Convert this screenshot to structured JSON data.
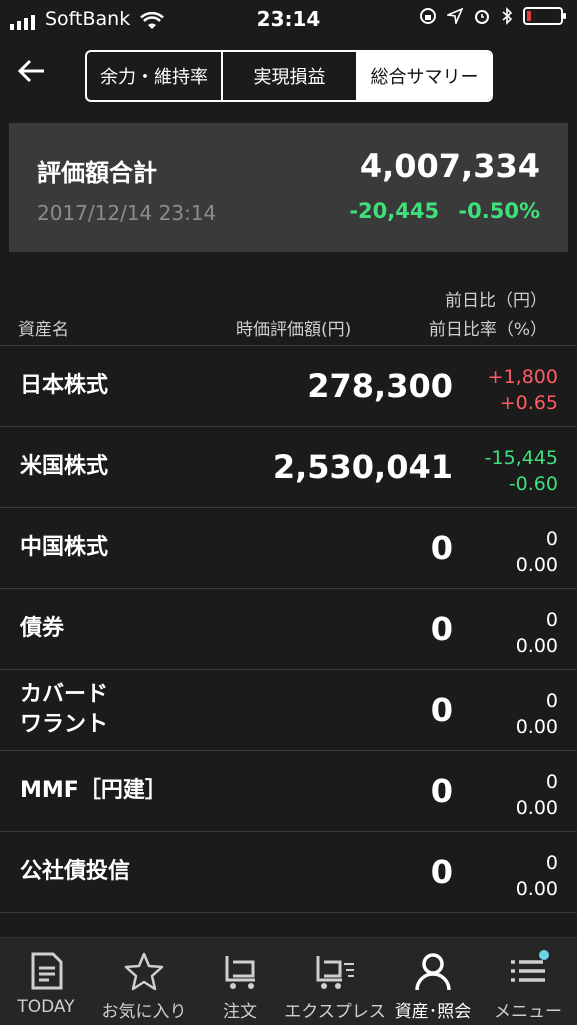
{
  "status_bar": {
    "carrier": "SoftBank",
    "time": "23:14"
  },
  "nav": {
    "segments": [
      "余力・維持率",
      "実現損益",
      "総合サマリー"
    ],
    "active_segment": "総合サマリー"
  },
  "summary": {
    "label": "評価額合計",
    "total": "4,007,334",
    "datetime": "2017/12/14 23:14",
    "change": "-20,445",
    "change_pct": "-0.50%"
  },
  "table": {
    "header": {
      "asset": "資産名",
      "value": "時価評価額(円)",
      "change": "前日比（円）",
      "change_pct": "前日比率（%）"
    },
    "rows": [
      {
        "name": "日本株式",
        "value": "278,300",
        "change": "+1,800",
        "change_pct": "+0.65",
        "dir": "up"
      },
      {
        "name": "米国株式",
        "value": "2,530,041",
        "change": "-15,445",
        "change_pct": "-0.60",
        "dir": "dn"
      },
      {
        "name": "中国株式",
        "value": "0",
        "change": "0",
        "change_pct": "0.00",
        "dir": "zero"
      },
      {
        "name": "債券",
        "value": "0",
        "change": "0",
        "change_pct": "0.00",
        "dir": "zero"
      },
      {
        "name": "カバード\nワラント",
        "value": "0",
        "change": "0",
        "change_pct": "0.00",
        "dir": "zero"
      },
      {
        "name": "MMF［円建］",
        "value": "0",
        "change": "0",
        "change_pct": "0.00",
        "dir": "zero"
      },
      {
        "name": "公社債投信",
        "value": "0",
        "change": "0",
        "change_pct": "0.00",
        "dir": "zero"
      }
    ]
  },
  "tabbar": {
    "items": [
      {
        "label": "TODAY",
        "icon": "document-icon"
      },
      {
        "label": "お気に入り",
        "icon": "star-icon"
      },
      {
        "label": "注文",
        "icon": "cart-icon"
      },
      {
        "label": "エクスプレス",
        "icon": "express-cart-icon"
      },
      {
        "label": "資産･照会",
        "icon": "person-icon"
      },
      {
        "label": "メニュー",
        "icon": "menu-icon"
      }
    ],
    "active": "資産･照会"
  },
  "colors": {
    "up": "#ff5b63",
    "down": "#3fe07c",
    "background": "#1b1b1b",
    "card": "#3a3a3a",
    "badge": "#6fd3e8"
  }
}
